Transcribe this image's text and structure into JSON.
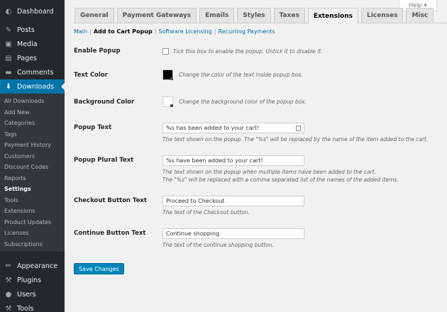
{
  "sidebar": {
    "top": [
      {
        "name": "dashboard",
        "label": "Dashboard",
        "icon": "◐"
      },
      {
        "name": "posts",
        "label": "Posts",
        "icon": "✎"
      },
      {
        "name": "media",
        "label": "Media",
        "icon": "▣"
      },
      {
        "name": "pages",
        "label": "Pages",
        "icon": "▤"
      },
      {
        "name": "comments",
        "label": "Comments",
        "icon": "▬"
      }
    ],
    "downloads": {
      "label": "Downloads",
      "icon": "⬇"
    },
    "submenu": [
      "All Downloads",
      "Add New",
      "Categories",
      "Tags",
      "Payment History",
      "Customers",
      "Discount Codes",
      "Reports",
      "Settings",
      "Tools",
      "Extensions",
      "Product Updates",
      "Licenses",
      "Subscriptions"
    ],
    "bottom": [
      {
        "name": "appearance",
        "label": "Appearance",
        "icon": "✏"
      },
      {
        "name": "plugins",
        "label": "Plugins",
        "icon": "⚒"
      },
      {
        "name": "users",
        "label": "Users",
        "icon": "●"
      },
      {
        "name": "tools",
        "label": "Tools",
        "icon": "⚒"
      }
    ]
  },
  "help": {
    "label": "Help",
    "arrow": "▾"
  },
  "tabs": [
    "General",
    "Payment Gateways",
    "Emails",
    "Styles",
    "Taxes",
    "Extensions",
    "Licenses",
    "Misc"
  ],
  "active_tab": "Extensions",
  "sublinks": {
    "main": "Main",
    "current": "Add to Cart Popup",
    "licensing": "Software Licensing",
    "recurring": "Recurring Payments",
    "sep": "|"
  },
  "form": {
    "enable_popup": {
      "label": "Enable Popup",
      "desc": "Tick this box to enable the popup. Untick it to disable it."
    },
    "text_color": {
      "label": "Text Color",
      "color": "#000000",
      "desc": "Change the color of the text inside popup box."
    },
    "background_color": {
      "label": "Background Color",
      "color": "#ffffff",
      "desc": "Change the background color of the popup box."
    },
    "popup_text": {
      "label": "Popup Text",
      "value": "%s has been added to your cart!",
      "desc": "The text shown on the popup. The \"%s\" will be replaced by the name of the item added to the cart."
    },
    "popup_plural": {
      "label": "Popup Plural Text",
      "value": "%s have been added to your cart!",
      "desc1": "The text shown on the popup when multiple items have been added to the cart.",
      "desc2": "The \"%s\" will be replaced with a comma separated list of the names of the added items."
    },
    "checkout_text": {
      "label": "Checkout Button Text",
      "value": "Proceed to Checkout",
      "desc": "The text of the Checkout button."
    },
    "continue_text": {
      "label": "Continue Button Text",
      "value": "Continue shopping",
      "desc": "The text of the continue shopping button."
    }
  },
  "save_label": "Save Changes"
}
